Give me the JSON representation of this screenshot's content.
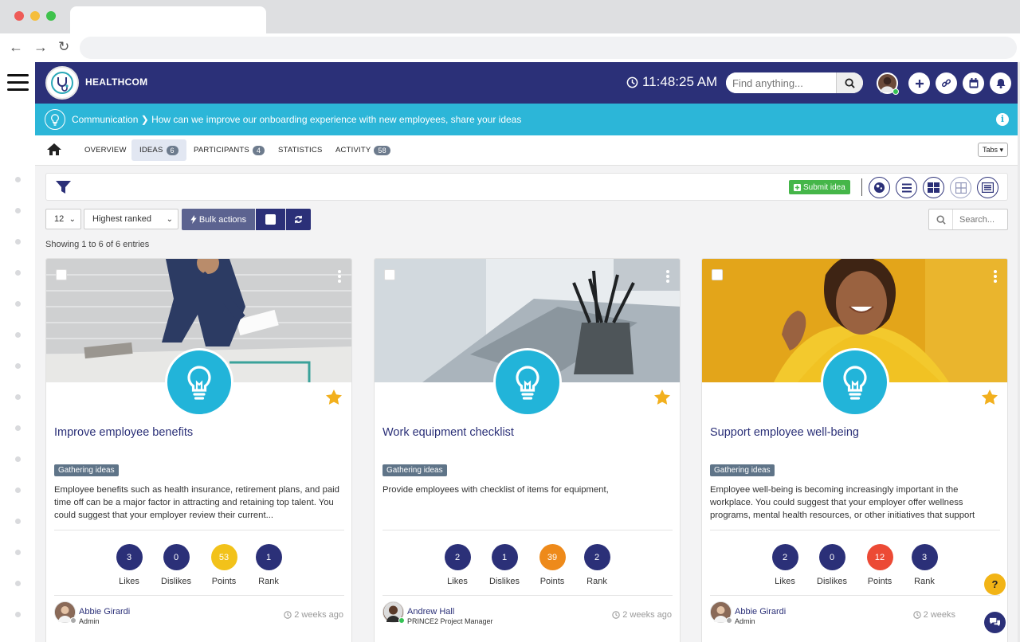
{
  "app": {
    "brand": "HEALTHCOM",
    "clock": "11:48:25 AM",
    "search_placeholder": "Find anything..."
  },
  "banner": {
    "text": "Communication ❯ How can we improve our onboarding experience with new employees, share your ideas"
  },
  "tabs": [
    {
      "label": "OVERVIEW",
      "count": ""
    },
    {
      "label": "IDEAS",
      "count": "6"
    },
    {
      "label": "PARTICIPANTS",
      "count": "4"
    },
    {
      "label": "STATISTICS",
      "count": ""
    },
    {
      "label": "ACTIVITY",
      "count": "58"
    }
  ],
  "tabs_dropdown": "Tabs ▾",
  "toolbar": {
    "submit_label": "Submit idea"
  },
  "controls": {
    "page_size": "12",
    "sort": "Highest ranked",
    "bulk_label": "Bulk actions",
    "search_placeholder": "Search..."
  },
  "showing_text": "Showing 1 to 6 of 6 entries",
  "stat_labels": {
    "likes": "Likes",
    "dislikes": "Dislikes",
    "points": "Points",
    "rank": "Rank"
  },
  "colors": {
    "navy": "#2b3078",
    "cyan": "#22b4d9",
    "points_yellow": "#f2c21a",
    "points_orange": "#ee8a1a",
    "points_red": "#ec4a35",
    "submit_green": "#45b649"
  },
  "cards": [
    {
      "title": "Improve employee benefits",
      "tag": "Gathering ideas",
      "description": "Employee benefits such as health insurance, retirement plans, and paid time off can be a major factor in attracting and retaining top talent. You could suggest that your employer review their current...",
      "likes": "3",
      "dislikes": "0",
      "points": "53",
      "rank": "1",
      "points_color": "#f2c21a",
      "author": "Abbie Girardi",
      "role": "Admin",
      "time": "2 weeks ago"
    },
    {
      "title": "Work equipment checklist",
      "tag": "Gathering ideas",
      "description": "Provide employees with checklist of items for equipment,",
      "likes": "2",
      "dislikes": "1",
      "points": "39",
      "rank": "2",
      "points_color": "#ee8a1a",
      "author": "Andrew Hall",
      "role": "PRINCE2 Project Manager",
      "time": "2 weeks ago"
    },
    {
      "title": "Support employee well-being",
      "tag": "Gathering ideas",
      "description": "Employee well-being is becoming increasingly important in the workplace. You could suggest that your employer offer wellness programs, mental health resources, or other initiatives that support",
      "likes": "2",
      "dislikes": "0",
      "points": "12",
      "rank": "3",
      "points_color": "#ec4a35",
      "author": "Abbie Girardi",
      "role": "Admin",
      "time": "2 weeks"
    }
  ]
}
